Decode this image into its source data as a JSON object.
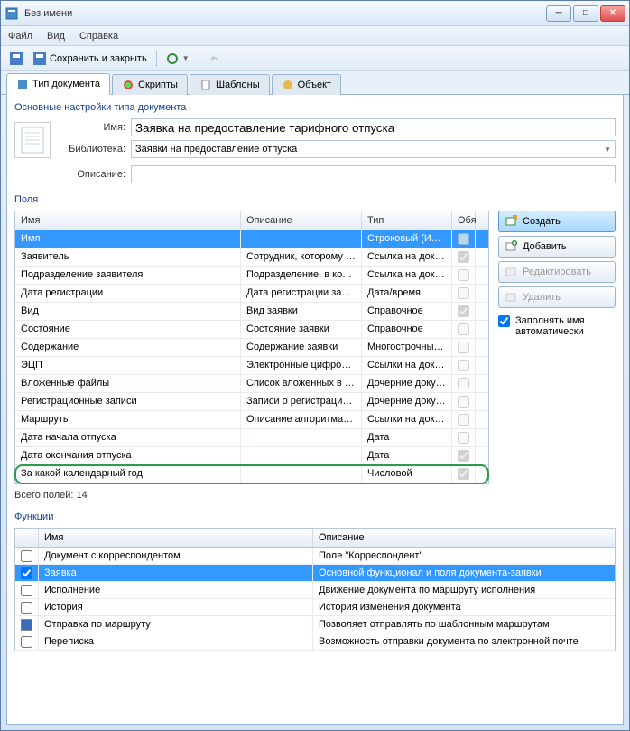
{
  "window": {
    "title": "Без имени"
  },
  "menu": {
    "file": "Файл",
    "view": "Вид",
    "help": "Справка"
  },
  "toolbar": {
    "save_close": "Сохранить и закрыть"
  },
  "tabs": [
    {
      "label": "Тип документа",
      "active": true
    },
    {
      "label": "Скрипты",
      "active": false
    },
    {
      "label": "Шаблоны",
      "active": false
    },
    {
      "label": "Объект",
      "active": false
    }
  ],
  "settings": {
    "section_title": "Основные настройки типа документа",
    "name_label": "Имя:",
    "name_value": "Заявка на предоставление тарифного отпуска",
    "library_label": "Библиотека:",
    "library_value": "Заявки на предоставление отпуска",
    "desc_label": "Описание:",
    "desc_value": ""
  },
  "fields": {
    "title": "Поля",
    "headers": {
      "name": "Имя",
      "desc": "Описание",
      "type": "Тип",
      "req": "Обя"
    },
    "rows": [
      {
        "name": "Имя",
        "desc": "",
        "type": "Строковый (Инд...",
        "req": false,
        "selected": true
      },
      {
        "name": "Заявитель",
        "desc": "Сотрудник, которому пр...",
        "type": "Ссылка на доку...",
        "req": true
      },
      {
        "name": "Подразделение заявителя",
        "desc": "Подразделение, в кото...",
        "type": "Ссылка на доку...",
        "req": false
      },
      {
        "name": "Дата регистрации",
        "desc": "Дата регистрации заявки",
        "type": "Дата/время",
        "req": false
      },
      {
        "name": "Вид",
        "desc": "Вид заявки",
        "type": "Справочное",
        "req": true
      },
      {
        "name": "Состояние",
        "desc": "Состояние заявки",
        "type": "Справочное",
        "req": false
      },
      {
        "name": "Содержание",
        "desc": "Содержание заявки",
        "type": "Многострочный ...",
        "req": false
      },
      {
        "name": "ЭЦП",
        "desc": "Электронные цифровые...",
        "type": "Ссылки на доку...",
        "req": false
      },
      {
        "name": "Вложенные файлы",
        "desc": "Список вложенных в до...",
        "type": "Дочерние докум...",
        "req": false
      },
      {
        "name": "Регистрационные записи",
        "desc": "Записи о регистрации д...",
        "type": "Дочерние докум...",
        "req": false
      },
      {
        "name": "Маршруты",
        "desc": "Описание алгоритма дв...",
        "type": "Ссылки на доку...",
        "req": false
      },
      {
        "name": "Дата начала отпуска",
        "desc": "",
        "type": "Дата",
        "req": false
      },
      {
        "name": "Дата окончания отпуска",
        "desc": "",
        "type": "Дата",
        "req": true
      },
      {
        "name": "За какой календарный год",
        "desc": "",
        "type": "Числовой",
        "req": true,
        "highlighted": true
      }
    ],
    "total": "Всего полей: 14",
    "buttons": {
      "create": "Создать",
      "add": "Добавить",
      "edit": "Редактировать",
      "delete": "Удалить"
    },
    "autofill": "Заполнять имя автоматически"
  },
  "functions": {
    "title": "Функции",
    "headers": {
      "name": "Имя",
      "desc": "Описание"
    },
    "rows": [
      {
        "checked": false,
        "name": "Документ с корреспондентом",
        "desc": "Поле \"Корреспондент\""
      },
      {
        "checked": true,
        "name": "Заявка",
        "desc": "Основной функционал и поля документа-заявки",
        "selected": true
      },
      {
        "checked": false,
        "name": "Исполнение",
        "desc": "Движение документа по маршруту исполнения"
      },
      {
        "checked": false,
        "name": "История",
        "desc": "История изменения документа"
      },
      {
        "checked": "partial",
        "name": "Отправка по маршруту",
        "desc": "Позволяет отправлять по шаблонным маршрутам"
      },
      {
        "checked": false,
        "name": "Переписка",
        "desc": "Возможность отправки документа по электронной почте"
      }
    ]
  }
}
